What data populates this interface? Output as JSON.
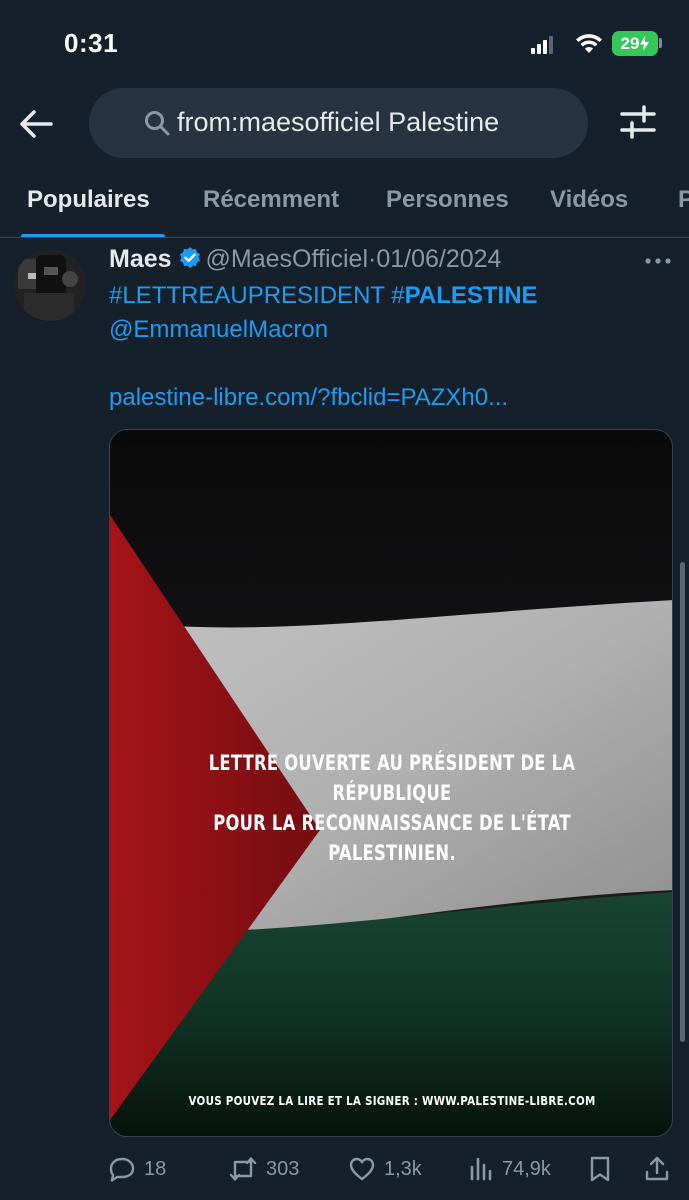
{
  "status_bar": {
    "time": "0:31",
    "battery": "29"
  },
  "search": {
    "query": "from:maesofficiel Palestine"
  },
  "tabs": [
    {
      "label": "Populaires",
      "active": true
    },
    {
      "label": "Récemment"
    },
    {
      "label": "Personnes"
    },
    {
      "label": "Vidéos"
    },
    {
      "label": "P"
    }
  ],
  "tweet": {
    "author_name": "Maes",
    "handle": "@MaesOfficiel",
    "separator": "·",
    "date": "01/06/2024",
    "hashtag1": "#LETTREAUPRESIDENT",
    "hashtag2_prefix": "#",
    "hashtag2_bold": "PALESTINE",
    "mention": "@EmmanuelMacron",
    "link": "palestine-libre.com/?fbclid=PAZXh0...",
    "media": {
      "title_line1": "LETTRE OUVERTE AU PRÉSIDENT DE LA RÉPUBLIQUE",
      "title_line2": "POUR LA RECONNAISSANCE DE L'ÉTAT PALESTINIEN.",
      "footer": "VOUS POUVEZ LA LIRE ET LA SIGNER : WWW.PALESTINE-LIBRE.COM"
    },
    "stats": {
      "replies": "18",
      "reposts": "303",
      "likes": "1,3k",
      "views": "74,9k"
    }
  },
  "colors": {
    "background": "#15202b",
    "accent": "#1d9bf0",
    "muted": "#8b98a5",
    "battery": "#34c759"
  }
}
